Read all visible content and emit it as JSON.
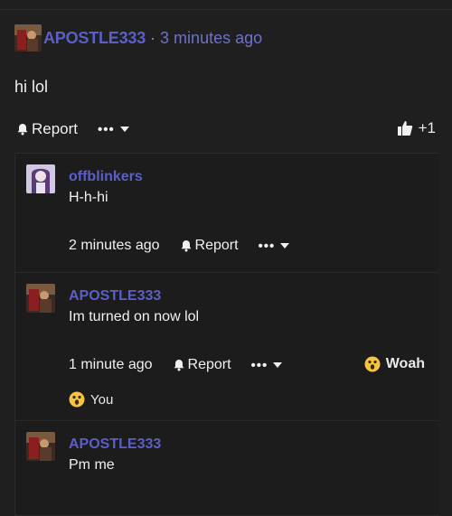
{
  "post": {
    "author": "APOSTLE333",
    "separator": "·",
    "time": "3 minutes ago",
    "text": "hi lol",
    "report_label": "Report",
    "more_label": "•••",
    "likes": "+1"
  },
  "replies": [
    {
      "author": "offblinkers",
      "text": "H-h-hi",
      "time": "2 minutes ago",
      "report_label": "Report",
      "more_label": "•••"
    },
    {
      "author": "APOSTLE333",
      "text": "Im turned on now lol",
      "time": "1 minute ago",
      "report_label": "Report",
      "more_label": "•••",
      "reaction_label": "Woah",
      "reacted_by": "You"
    },
    {
      "author": "APOSTLE333",
      "text": "Pm me"
    }
  ],
  "colors": {
    "background": "#1f1f1f",
    "username": "#5b5fc7",
    "text": "#f0f0f0"
  }
}
